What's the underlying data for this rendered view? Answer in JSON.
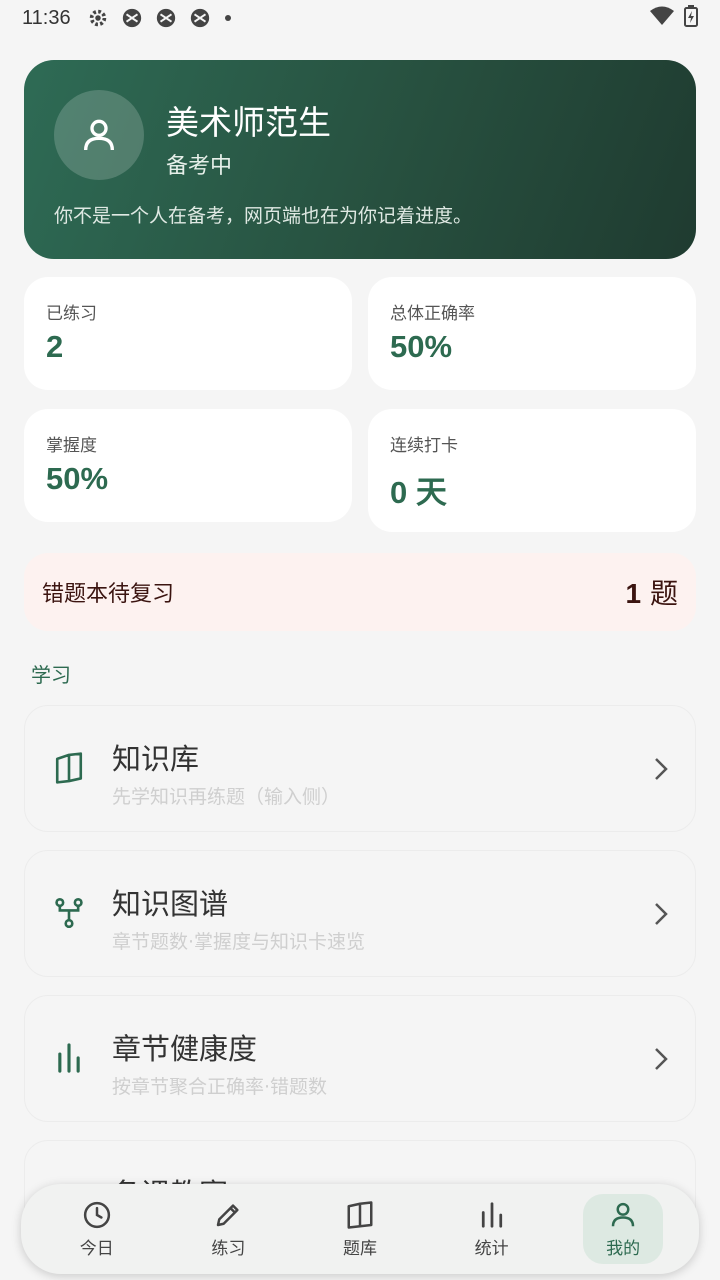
{
  "status_bar": {
    "time": "11:36"
  },
  "profile": {
    "name": "美术师范生",
    "status": "备考中",
    "motto": "你不是一个人在备考，网页端也在为你记着进度。"
  },
  "stats": [
    {
      "label": "已练习",
      "value": "2"
    },
    {
      "label": "总体正确率",
      "value": "50%"
    },
    {
      "label": "掌握度",
      "value": "50%"
    },
    {
      "label": "连续打卡",
      "value": "0 天"
    }
  ],
  "wrong_book": {
    "label": "错题本待复习",
    "count": "1",
    "unit": "题"
  },
  "section": {
    "title": "学习"
  },
  "menu": [
    {
      "title": "知识库",
      "subtitle": "先学知识再练题（输入侧）",
      "icon": "book-icon"
    },
    {
      "title": "知识图谱",
      "subtitle": "章节题数·掌握度与知识卡速览",
      "icon": "graph-icon"
    },
    {
      "title": "章节健康度",
      "subtitle": "按章节聚合正确率·错题数",
      "icon": "bar-chart-icon"
    },
    {
      "title": "备课教案",
      "subtitle": "",
      "icon": ""
    }
  ],
  "nav": [
    {
      "label": "今日",
      "icon": "clock-icon"
    },
    {
      "label": "练习",
      "icon": "pencil-icon"
    },
    {
      "label": "题库",
      "icon": "book-icon"
    },
    {
      "label": "统计",
      "icon": "bar-chart-icon"
    },
    {
      "label": "我的",
      "icon": "person-icon"
    }
  ],
  "colors": {
    "accent": "#2d6a50",
    "card_gradient_start": "#2e6b55",
    "card_gradient_end": "#1f3b30",
    "wrong_bg": "#fdf2f0"
  }
}
